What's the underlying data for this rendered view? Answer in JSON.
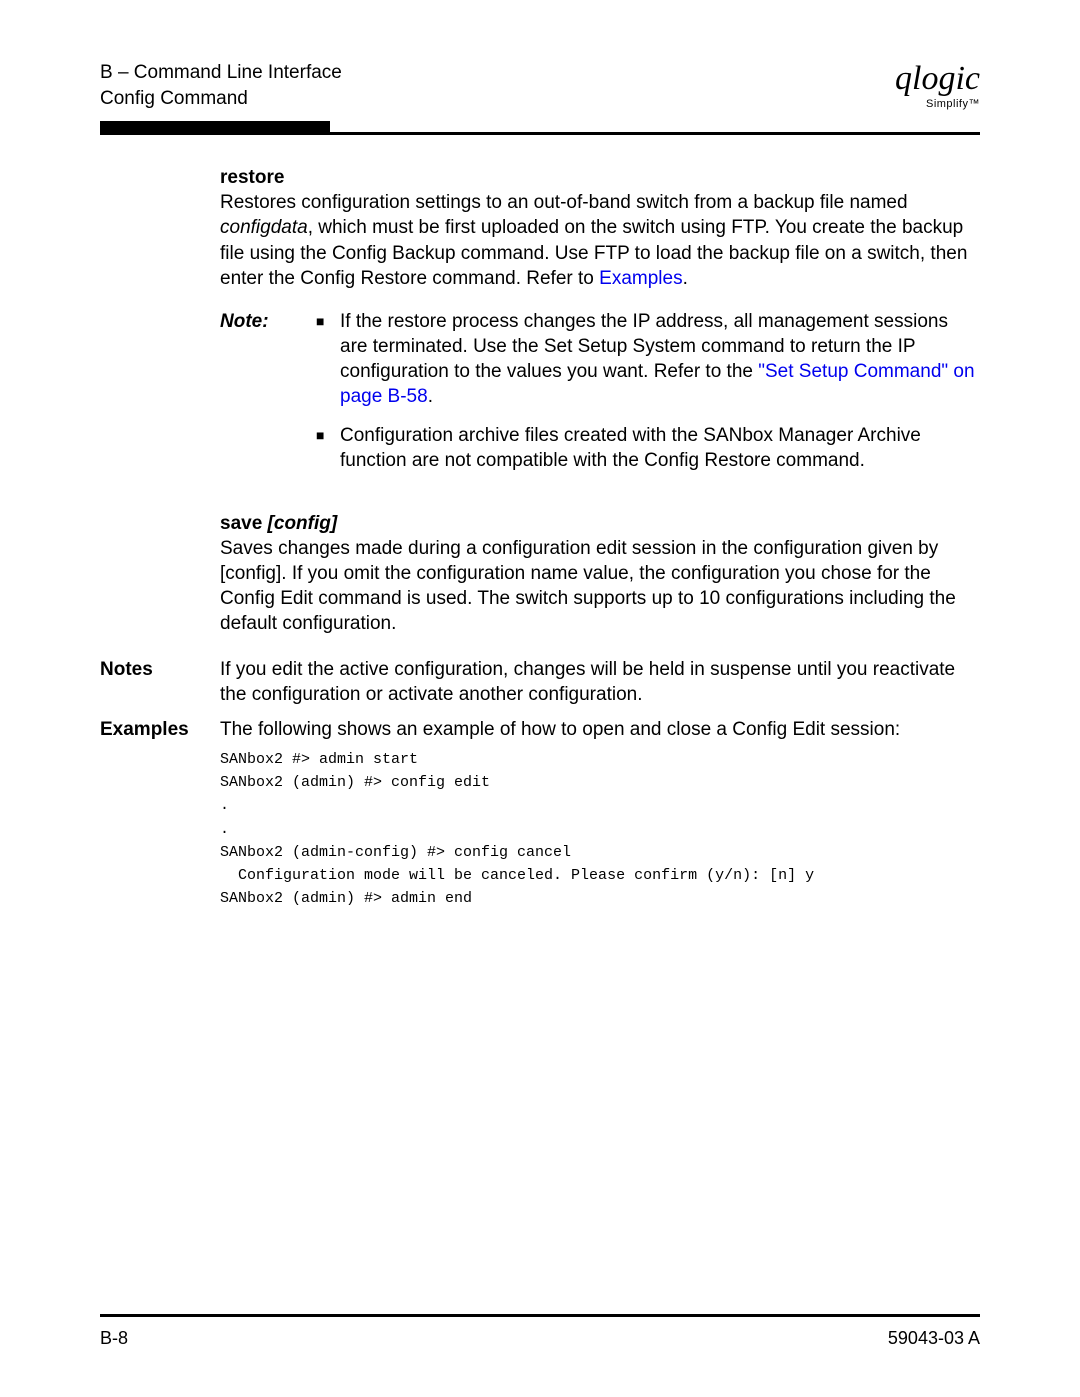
{
  "header": {
    "line1": "B – Command Line Interface",
    "line2": "Config Command",
    "logo": "qlogic",
    "logo_sub": "Simplify™"
  },
  "sections": {
    "restore": {
      "heading": "restore",
      "body_pre": "Restores configuration settings to an out-of-band switch from a backup file named ",
      "body_em": "configdata",
      "body_post": ", which must be first uploaded on the switch using FTP. You create the backup file using the Config Backup command. Use FTP to load the backup file on a switch, then enter the Config Restore command. Refer to ",
      "link1": "Examples",
      "body_tail": "."
    },
    "note": {
      "label": "Note:",
      "item1_pre": "If the restore process changes the IP address, all management sessions are terminated. Use the Set Setup System command to return the IP configuration to the values you want. Refer to the ",
      "item1_link": "\"Set Setup Command\" on page B-58",
      "item1_post": ".",
      "item2": "Configuration archive files created with the SANbox Manager Archive function are not compatible with the Config Restore command."
    },
    "save": {
      "heading": "save ",
      "heading_arg": "[config]",
      "body": "Saves changes made during a configuration edit session in the configuration given by [config]. If you omit the configuration name value, the configuration you chose for the Config Edit command is used. The switch supports up to 10 configurations including the default configuration."
    },
    "notes": {
      "label": "Notes",
      "body": "If you edit the active configuration, changes will be held in suspense until you reactivate the configuration or activate another configuration."
    },
    "examples": {
      "label": "Examples",
      "intro": "The following shows an example of how to open and close a Config Edit session:",
      "code": "SANbox2 #> admin start\nSANbox2 (admin) #> config edit\n.\n.\nSANbox2 (admin-config) #> config cancel\n  Configuration mode will be canceled. Please confirm (y/n): [n] y\nSANbox2 (admin) #> admin end"
    }
  },
  "footer": {
    "left": "B-8",
    "right": "59043-03  A"
  }
}
